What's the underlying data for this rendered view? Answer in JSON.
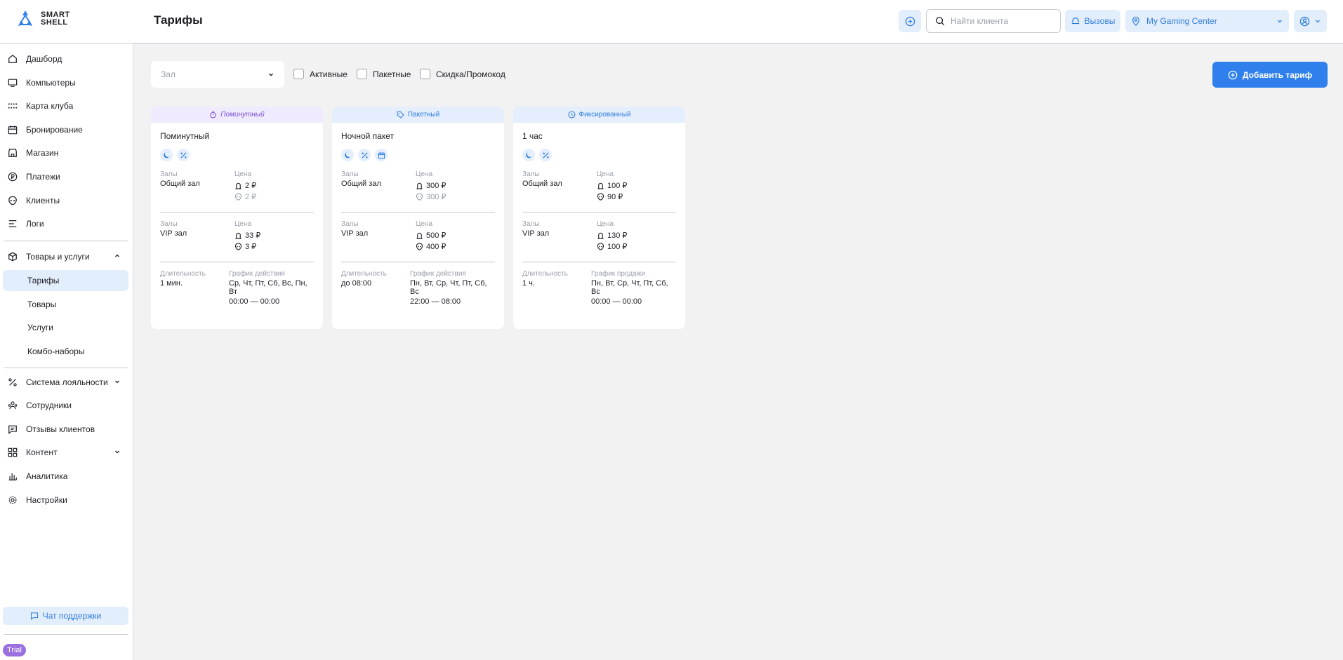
{
  "brand": {
    "line1": "SMART",
    "line2": "SHELL"
  },
  "header": {
    "title": "Тарифы",
    "search_placeholder": "Найти клиента",
    "calls_label": "Вызовы",
    "club_name": "My Gaming Center"
  },
  "sidebar": {
    "items": [
      {
        "label": "Дашборд"
      },
      {
        "label": "Компьютеры"
      },
      {
        "label": "Карта клуба"
      },
      {
        "label": "Бронирование"
      },
      {
        "label": "Магазин"
      },
      {
        "label": "Платежи"
      },
      {
        "label": "Клиенты"
      },
      {
        "label": "Логи"
      },
      {
        "label": "Товары и услуги"
      },
      {
        "label": "Тарифы"
      },
      {
        "label": "Товары"
      },
      {
        "label": "Услуги"
      },
      {
        "label": "Комбо-наборы"
      },
      {
        "label": "Система лояльности"
      },
      {
        "label": "Сотрудники"
      },
      {
        "label": "Отзывы клиентов"
      },
      {
        "label": "Контент"
      },
      {
        "label": "Аналитика"
      },
      {
        "label": "Настройки"
      }
    ],
    "support_label": "Чат поддержки",
    "trial_label": "Trial"
  },
  "toolbar": {
    "hall_placeholder": "Зал",
    "filter_active": "Активные",
    "filter_package": "Пакетные",
    "filter_discount": "Скидка/Промокод",
    "add_label": "Добавить тариф"
  },
  "cards": [
    {
      "type_label": "Поминутный",
      "name": "Поминутный",
      "halls_label": "Залы",
      "price_label": "Цена",
      "hall1": "Общий зал",
      "hall1_price_a": "2 ₽",
      "hall1_price_b": "2 ₽",
      "hall2": "VIP зал",
      "hall2_price_a": "33 ₽",
      "hall2_price_b": "3 ₽",
      "duration_label": "Длительность",
      "duration": "1 мин.",
      "schedule_label": "График действия",
      "schedule_days": "Ср, Чт, Пт, Сб, Вс, Пн, Вт",
      "schedule_time": "00:00 — 00:00"
    },
    {
      "type_label": "Пакетный",
      "name": "Ночной пакет",
      "halls_label": "Залы",
      "price_label": "Цена",
      "hall1": "Общий зал",
      "hall1_price_a": "300 ₽",
      "hall1_price_b": "300 ₽",
      "hall2": "VIP зал",
      "hall2_price_a": "500 ₽",
      "hall2_price_b": "400 ₽",
      "duration_label": "Длительность",
      "duration": "до 08:00",
      "schedule_label": "График действия",
      "schedule_days": "Пн, Вт, Ср, Чт, Пт, Сб, Вс",
      "schedule_time": "22:00 — 08:00"
    },
    {
      "type_label": "Фиксированный",
      "name": "1 час",
      "halls_label": "Залы",
      "price_label": "Цена",
      "hall1": "Общий зал",
      "hall1_price_a": "100 ₽",
      "hall1_price_b": "90 ₽",
      "hall2": "VIP зал",
      "hall2_price_a": "130 ₽",
      "hall2_price_b": "100 ₽",
      "duration_label": "Длительность",
      "duration": "1 ч.",
      "schedule_label": "График продажи",
      "schedule_days": "Пн, Вт, Ср, Чт, Пт, Сб, Вс",
      "schedule_time": "00:00 — 00:00"
    }
  ],
  "colors": {
    "accent": "#2f80ed",
    "accent_light": "#e3eefc",
    "purple": "#7c4fd6",
    "trial": "#9b6fe0"
  }
}
